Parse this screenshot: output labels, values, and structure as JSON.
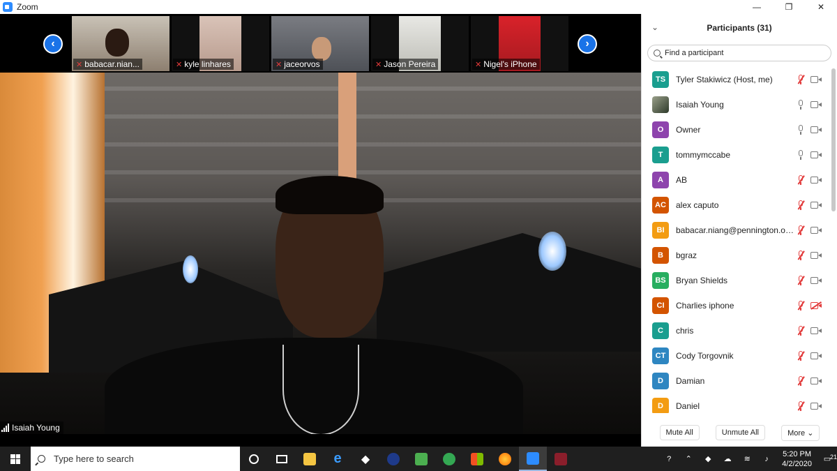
{
  "window": {
    "title": "Zoom",
    "controls": [
      "—",
      "❐",
      "✕"
    ]
  },
  "gallery": {
    "prev_label": "‹",
    "next_label": "›",
    "thumbnails": [
      {
        "name": "babacar.nian..."
      },
      {
        "name": "kyle linhares"
      },
      {
        "name": "jaceorvos"
      },
      {
        "name": "Jason Pereira"
      },
      {
        "name": "Nigel's iPhone"
      }
    ]
  },
  "main_video": {
    "speaker_name": "Isaiah Young"
  },
  "participants_panel": {
    "title": "Participants (31)",
    "search_placeholder": "Find a participant",
    "participants": [
      {
        "initials": "TS",
        "name": "Tyler Stakiwicz (Host, me)",
        "color": "#1a9e8f",
        "mic_muted": true,
        "cam_off": false
      },
      {
        "initials": "",
        "name": "Isaiah Young",
        "color": "#3d4a3a",
        "mic_muted": false,
        "cam_off": false
      },
      {
        "initials": "O",
        "name": "Owner",
        "color": "#8e44ad",
        "mic_muted": false,
        "cam_off": false
      },
      {
        "initials": "T",
        "name": "tommymccabe",
        "color": "#1a9e8f",
        "mic_muted": false,
        "cam_off": false
      },
      {
        "initials": "A",
        "name": "AB",
        "color": "#8e44ad",
        "mic_muted": true,
        "cam_off": false
      },
      {
        "initials": "AC",
        "name": "alex caputo",
        "color": "#d35400",
        "mic_muted": true,
        "cam_off": false
      },
      {
        "initials": "BI",
        "name": "babacar.niang@pennington.org...",
        "color": "#f39c12",
        "mic_muted": true,
        "cam_off": false
      },
      {
        "initials": "B",
        "name": "bgraz",
        "color": "#d35400",
        "mic_muted": true,
        "cam_off": false
      },
      {
        "initials": "BS",
        "name": "Bryan Shields",
        "color": "#27ae60",
        "mic_muted": true,
        "cam_off": false
      },
      {
        "initials": "CI",
        "name": "Charlies iphone",
        "color": "#d35400",
        "mic_muted": true,
        "cam_off": true
      },
      {
        "initials": "C",
        "name": "chris",
        "color": "#1a9e8f",
        "mic_muted": true,
        "cam_off": false
      },
      {
        "initials": "CT",
        "name": "Cody Torgovnik",
        "color": "#2e86c1",
        "mic_muted": true,
        "cam_off": false
      },
      {
        "initials": "D",
        "name": "Damian",
        "color": "#2e86c1",
        "mic_muted": true,
        "cam_off": false
      },
      {
        "initials": "D",
        "name": "Daniel",
        "color": "#f39c12",
        "mic_muted": true,
        "cam_off": false
      }
    ],
    "buttons": {
      "mute_all": "Mute All",
      "unmute_all": "Unmute All",
      "more": "More ⌄"
    }
  },
  "taskbar": {
    "search_placeholder": "Type here to search",
    "apps": [
      "cortana",
      "task-view",
      "file-explorer",
      "edge",
      "dropbox",
      "media-player",
      "evernote",
      "tripadvisor",
      "store",
      "firefox",
      "zoom",
      "video-editor"
    ],
    "time": "5:20 PM",
    "date": "4/2/2020",
    "notification_count": "21"
  }
}
